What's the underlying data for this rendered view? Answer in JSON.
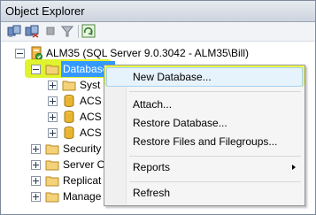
{
  "panel": {
    "title": "Object Explorer"
  },
  "toolbar": {
    "buttons": [
      "connect-icon",
      "disconnect-icon",
      "stop-icon",
      "filter-icon",
      "refresh-icon"
    ]
  },
  "tree": {
    "server_label": "ALM35 (SQL Server 9.0.3042 - ALM35\\Bill)",
    "databases_label": "Databases",
    "children": [
      "Syst",
      "ACS",
      "ACS",
      "ACS"
    ],
    "siblings": [
      "Security",
      "Server O",
      "Replicat",
      "Manage"
    ]
  },
  "context_menu": {
    "items": {
      "new_database": "New Database...",
      "attach": "Attach...",
      "restore_database": "Restore Database...",
      "restore_files": "Restore Files and Filegroups...",
      "reports": "Reports",
      "refresh": "Refresh"
    }
  },
  "colors": {
    "highlighter": "#d9f20a",
    "selection": "#3399ff"
  }
}
